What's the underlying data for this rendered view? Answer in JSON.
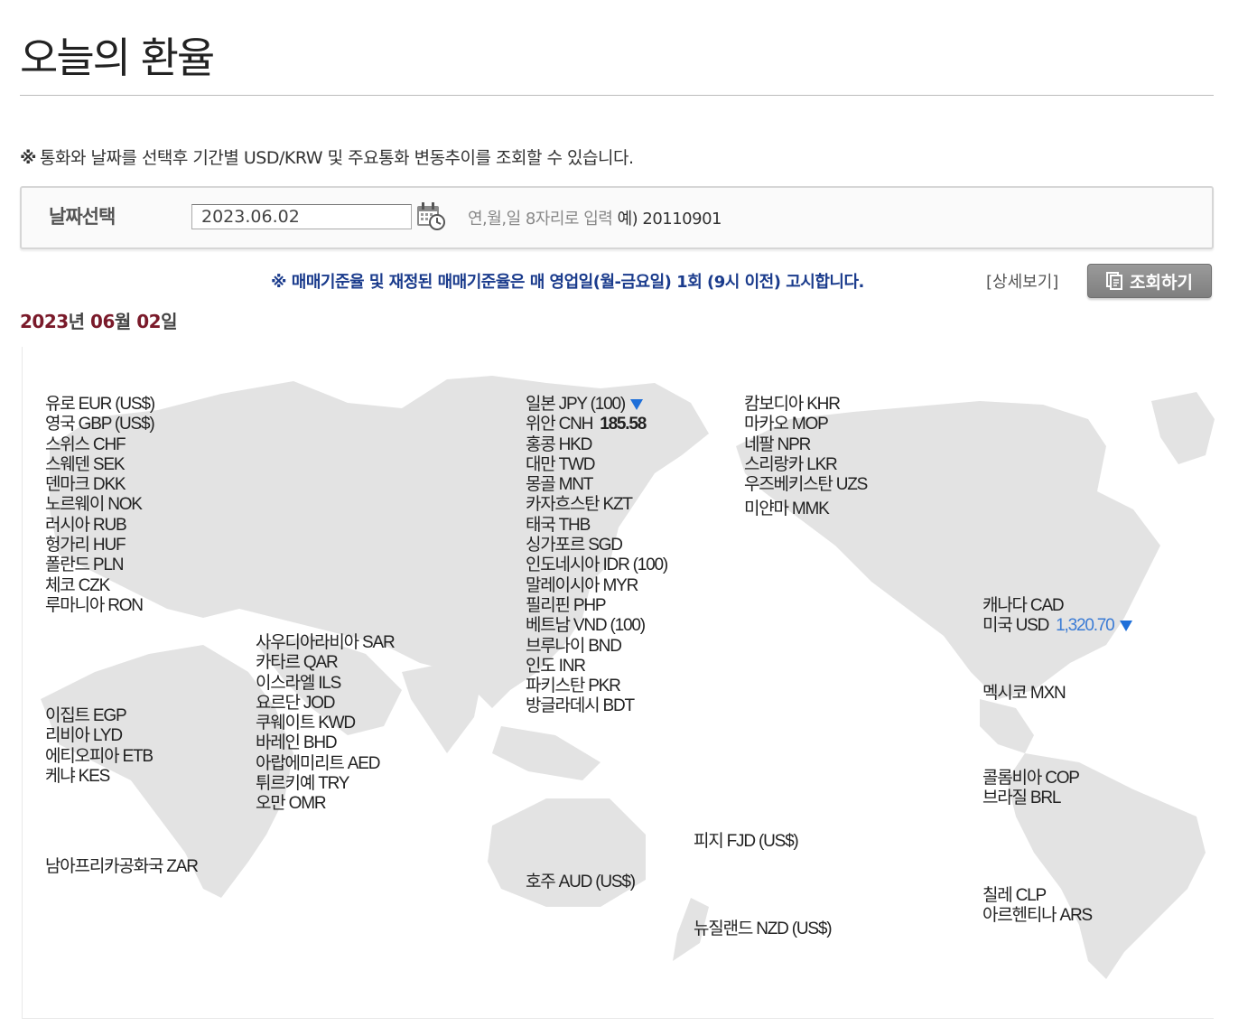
{
  "page": {
    "title": "오늘의 환율"
  },
  "notice": {
    "mark": "※",
    "text": "통화와 날짜를 선택후 기간별 USD/KRW 및 주요통화 변동추이를 조회할 수 있습니다."
  },
  "date_select": {
    "label": "날짜선택",
    "value": "2023.06.02",
    "hint": "연,월,일 8자리로 입력",
    "example": "예) 20110901",
    "calendar_icon": "calendar-clock-icon"
  },
  "policy": {
    "text": "※ 매매기준율 및 재정된 매매기준율은 매 영업일(월-금요일) 1회 (9시 이전) 고시합니다.",
    "detail_link": "[상세보기]",
    "search_button": "조회하기",
    "search_icon": "document-icon"
  },
  "current_date": {
    "year": "2023",
    "year_unit": "년",
    "month": "06",
    "month_unit": "월",
    "day": "02",
    "day_unit": "일"
  },
  "colors": {
    "map_fill": "#e3e3e3",
    "policy_text": "#1a3b8c",
    "date_number": "#7a1a2a",
    "rate_blue": "#3a7bd5",
    "down_arrow": "#1e6fd9"
  },
  "groups": {
    "europe": [
      {
        "label": "유로 EUR (US$)"
      },
      {
        "label": "영국 GBP (US$)"
      },
      {
        "label": "스위스 CHF"
      },
      {
        "label": "스웨덴 SEK"
      },
      {
        "label": "덴마크 DKK"
      },
      {
        "label": "노르웨이 NOK"
      },
      {
        "label": "러시아 RUB"
      },
      {
        "label": "헝가리 HUF"
      },
      {
        "label": "폴란드 PLN"
      },
      {
        "label": "체코 CZK"
      },
      {
        "label": "루마니아 RON"
      }
    ],
    "africa": [
      {
        "label": "이집트 EGP"
      },
      {
        "label": "리비아 LYD"
      },
      {
        "label": "에티오피아 ETB"
      },
      {
        "label": "케냐 KES"
      }
    ],
    "south_africa": [
      {
        "label": "남아프리카공화국 ZAR"
      }
    ],
    "middle_east": [
      {
        "label": "사우디아라비아 SAR"
      },
      {
        "label": "카타르 QAR"
      },
      {
        "label": "이스라엘 ILS"
      },
      {
        "label": "요르단 JOD"
      },
      {
        "label": "쿠웨이트 KWD"
      },
      {
        "label": "바레인 BHD"
      },
      {
        "label": "아랍에미리트 AED"
      },
      {
        "label": "튀르키예 TRY"
      },
      {
        "label": "오만 OMR"
      }
    ],
    "asia": [
      {
        "label": "일본 JPY (100)",
        "value": "",
        "down": true
      },
      {
        "label": "위안 CNH",
        "value": "185.58"
      },
      {
        "label": "홍콩 HKD"
      },
      {
        "label": "대만 TWD"
      },
      {
        "label": "몽골 MNT"
      },
      {
        "label": "카자흐스탄 KZT"
      },
      {
        "label": "태국 THB"
      },
      {
        "label": "싱가포르 SGD"
      },
      {
        "label": "인도네시아 IDR (100)"
      },
      {
        "label": "말레이시아 MYR"
      },
      {
        "label": "필리핀 PHP"
      },
      {
        "label": "베트남 VND (100)"
      },
      {
        "label": "브루나이 BND"
      },
      {
        "label": "인도 INR"
      },
      {
        "label": "파키스탄 PKR"
      },
      {
        "label": "방글라데시 BDT"
      }
    ],
    "asia2": [
      {
        "label": "캄보디아 KHR"
      },
      {
        "label": "마카오 MOP"
      },
      {
        "label": "네팔 NPR"
      },
      {
        "label": "스리랑카 LKR"
      },
      {
        "label": "우즈베키스탄 UZS"
      }
    ],
    "myanmar": [
      {
        "label": "미얀마 MMK"
      }
    ],
    "north_america": [
      {
        "label": "캐나다 CAD"
      },
      {
        "label": "미국 USD",
        "value": "1,320.70",
        "down": true
      }
    ],
    "mexico": [
      {
        "label": "멕시코 MXN"
      }
    ],
    "south_america": [
      {
        "label": "콜롬비아 COP"
      },
      {
        "label": "브라질 BRL"
      }
    ],
    "south_america2": [
      {
        "label": "칠레 CLP"
      },
      {
        "label": "아르헨티나 ARS"
      }
    ],
    "oceania_au": [
      {
        "label": "호주 AUD (US$)"
      }
    ],
    "oceania_fj": [
      {
        "label": "피지 FJD (US$)"
      }
    ],
    "oceania_nz": [
      {
        "label": "뉴질랜드 NZD (US$)"
      }
    ]
  }
}
